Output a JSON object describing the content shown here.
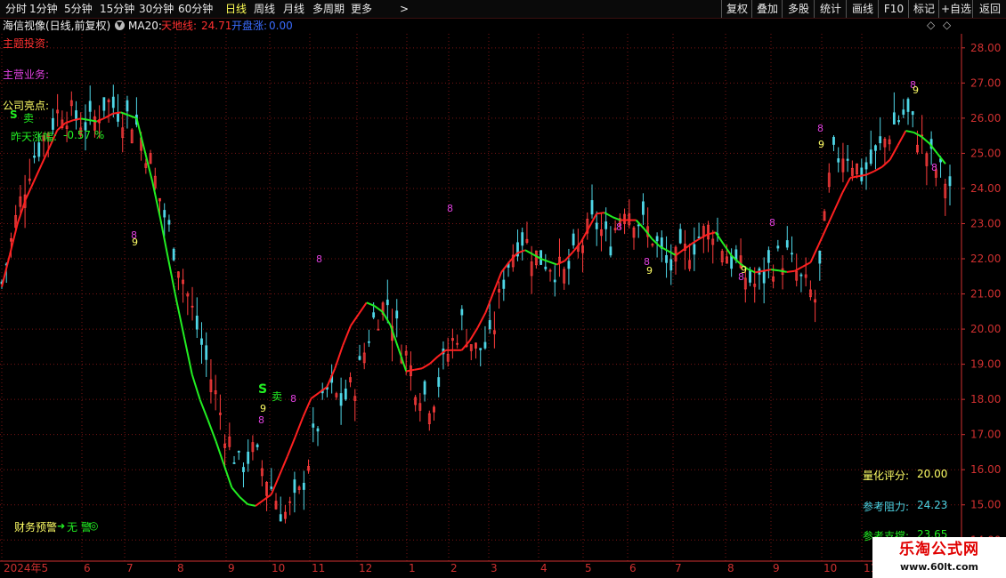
{
  "toolbar": {
    "periods": [
      "分时",
      "1分钟",
      "5分钟",
      "15分钟",
      "30分钟",
      "60分钟",
      "日线",
      "周线",
      "月线",
      "多周期",
      "更多"
    ],
    "active_period": "日线",
    "more_arrow": ">",
    "right_buttons": [
      "复权",
      "叠加",
      "多股",
      "统计",
      "画线",
      "F10",
      "标记",
      "+自选",
      "返回"
    ]
  },
  "infobar": {
    "stock": "海信视像(日线,前复权)",
    "indicator": "MA20:",
    "tiandi_label": "天地线:",
    "tiandi_value": "24.71",
    "kaipan_label": "开盘涨:",
    "kaipan_value": "0.00",
    "diamond": "◇",
    "gear": "◇"
  },
  "annotations": {
    "theme": "主题投资:",
    "business": "主营业务:",
    "highlight": "公司亮点:",
    "prev_change_label": "昨天涨幅:",
    "prev_change_value": "-0.57 %",
    "finance_warning": "财务预警",
    "finance_status": "无 警",
    "quant_label": "量化评分:",
    "quant_value": "20.00",
    "resist_label": "参考阻力:",
    "resist_value": "24.23",
    "support_label": "参考支撑:",
    "support_value": "23.65",
    "sell_marker": "S",
    "sell_text": "卖",
    "count8": "8",
    "count9": "9"
  },
  "watermark": {
    "line1": "乐淘公式网",
    "line2": "www.60lt.com"
  },
  "colors": {
    "up": "#ff3c3c",
    "down": "#4fd6e6",
    "ma_up": "#ff2020",
    "ma_down": "#22ee22",
    "grid": "#7a1414",
    "axis": "#d03030",
    "count": "#e040e0",
    "count9": "#ffff66"
  },
  "chart_data": {
    "type": "candlestick",
    "title": "海信视像(日线,前复权)",
    "ylim": [
      13.4,
      28.4
    ],
    "yticks": [
      14.0,
      15.0,
      16.0,
      17.0,
      18.0,
      19.0,
      20.0,
      21.0,
      22.0,
      23.0,
      24.0,
      25.0,
      26.0,
      27.0,
      28.0
    ],
    "xticks": [
      "2024年5",
      "6",
      "7",
      "8",
      "9",
      "10",
      "11",
      "12",
      "1",
      "2",
      "3",
      "4",
      "5",
      "6",
      "7",
      "8",
      "9",
      "10",
      "11"
    ],
    "close_path": [
      21.3,
      23.2,
      24.8,
      25.6,
      26.3,
      26.0,
      25.8,
      26.5,
      26.2,
      25.9,
      24.8,
      23.2,
      21.8,
      20.3,
      18.8,
      17.2,
      16.1,
      16.5,
      15.7,
      14.7,
      15.1,
      16.8,
      18.3,
      17.9,
      18.6,
      20.2,
      20.8,
      19.6,
      18.4,
      17.9,
      19.2,
      20.2,
      19.4,
      19.6,
      21.7,
      22.7,
      22.1,
      21.9,
      21.5,
      22.3,
      23.1,
      22.4,
      23.6,
      23.1,
      22.6,
      21.7,
      22.1,
      22.6,
      22.9,
      22.1,
      21.6,
      21.2,
      21.9,
      22.1,
      21.3,
      20.8,
      24.8,
      25.1,
      24.4,
      24.9,
      25.7,
      26.2,
      25.4,
      24.6,
      24.1
    ],
    "ma20_path": [
      21.2,
      23.4,
      24.6,
      25.8,
      26.0,
      25.9,
      26.2,
      26.0,
      23.8,
      21.0,
      18.4,
      17.0,
      15.4,
      14.9,
      15.3,
      16.6,
      18.0,
      18.4,
      20.0,
      20.8,
      20.4,
      18.8,
      18.9,
      19.4,
      19.4,
      20.3,
      21.7,
      22.3,
      22.0,
      21.8,
      22.4,
      23.4,
      23.1,
      23.1,
      22.4,
      22.1,
      22.5,
      22.8,
      22.0,
      21.6,
      21.7,
      21.6,
      21.9,
      23.1,
      24.3,
      24.4,
      24.7,
      25.7,
      25.4,
      24.7
    ]
  }
}
